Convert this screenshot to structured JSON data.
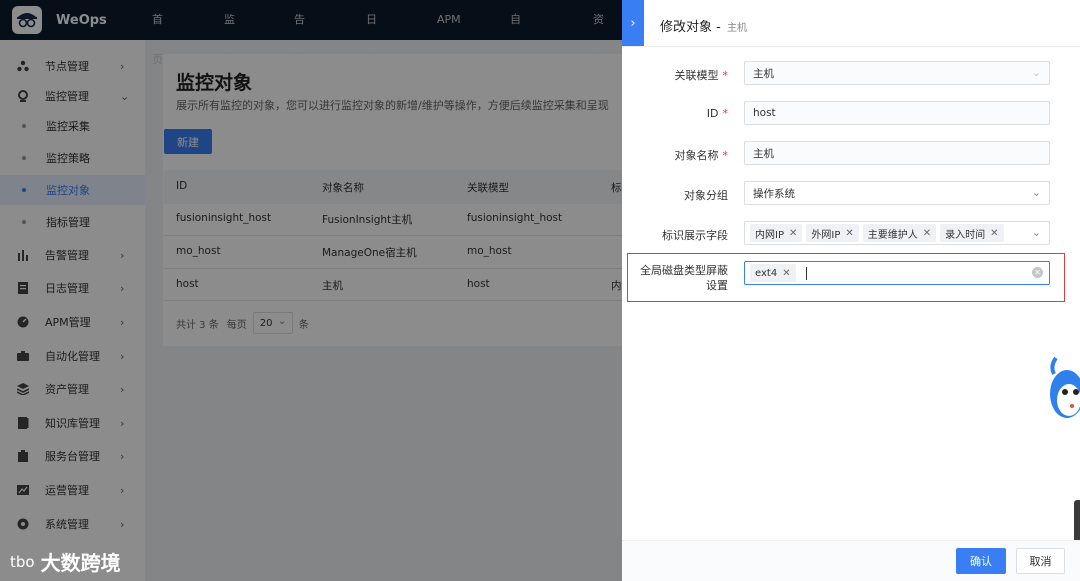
{
  "app": {
    "name": "WeOps"
  },
  "topnav": [
    "首页",
    "监控",
    "告警",
    "日志",
    "APM",
    "自动化",
    "资产"
  ],
  "sidebar": {
    "items": [
      {
        "label": "节点管理",
        "icon": "nodes-icon",
        "expanded": false
      },
      {
        "label": "监控管理",
        "icon": "monitor-icon",
        "expanded": true
      },
      {
        "label": "告警管理",
        "icon": "alarm-icon",
        "expanded": false
      },
      {
        "label": "日志管理",
        "icon": "log-icon",
        "expanded": false
      },
      {
        "label": "APM管理",
        "icon": "apm-icon",
        "expanded": false
      },
      {
        "label": "自动化管理",
        "icon": "automation-icon",
        "expanded": false
      },
      {
        "label": "资产管理",
        "icon": "asset-icon",
        "expanded": false
      },
      {
        "label": "知识库管理",
        "icon": "knowledge-icon",
        "expanded": false
      },
      {
        "label": "服务台管理",
        "icon": "service-desk-icon",
        "expanded": false
      },
      {
        "label": "运营管理",
        "icon": "operations-icon",
        "expanded": false
      },
      {
        "label": "系统管理",
        "icon": "system-icon",
        "expanded": false
      }
    ],
    "sub_items": [
      "监控采集",
      "监控策略",
      "监控对象",
      "指标管理"
    ],
    "active_sub": "监控对象"
  },
  "main": {
    "title": "监控对象",
    "description": "展示所有监控的对象，您可以进行监控对象的新增/维护等操作，方便后续监控采集和呈现",
    "new_button": "新建",
    "table": {
      "columns": [
        "ID",
        "对象名称",
        "关联模型",
        "标"
      ],
      "rows": [
        [
          "fusioninsight_host",
          "FusionInsight主机",
          "fusioninsight_host",
          ""
        ],
        [
          "mo_host",
          "ManageOne宿主机",
          "mo_host",
          ""
        ],
        [
          "host",
          "主机",
          "host",
          "内"
        ]
      ]
    },
    "pager": {
      "total": "共计 3 条",
      "per_page_label": "每页",
      "per_page": "20",
      "unit": "条"
    }
  },
  "drawer": {
    "title": "修改对象 -",
    "subtitle": "主机",
    "fields": {
      "model": {
        "label": "关联模型",
        "required": true,
        "value": "主机"
      },
      "id": {
        "label": "ID",
        "required": true,
        "value": "host"
      },
      "name": {
        "label": "对象名称",
        "required": true,
        "value": "主机"
      },
      "group": {
        "label": "对象分组",
        "required": false,
        "value": "操作系统"
      },
      "display_fields": {
        "label": "标识展示字段",
        "required": false,
        "tags": [
          "内网IP",
          "外网IP",
          "主要维护人",
          "录入时间"
        ]
      },
      "disk_mask": {
        "label_line1": "全局磁盘类型屏蔽",
        "label_line2": "设置",
        "required": false,
        "tags": [
          "ext4"
        ]
      }
    },
    "confirm_button": "确认",
    "cancel_button": "取消"
  },
  "watermark": {
    "logo": "tbo",
    "text": "大数跨境"
  },
  "colors": {
    "primary": "#3a7ef4",
    "topbar": "#0c1a2c",
    "highlight": "#e53a3a",
    "required": "#ea3636"
  }
}
